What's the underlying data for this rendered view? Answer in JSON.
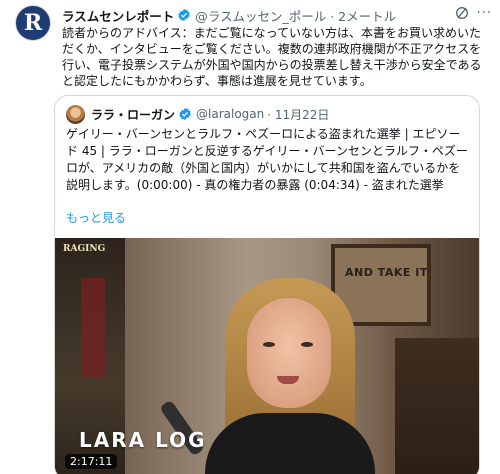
{
  "tweet": {
    "avatar_letter": "R",
    "author_name": "ラスムセンレポート",
    "handle_time": "@ラスムッセン_ポール · 2メートル",
    "more_label": "···",
    "text": "読者からのアドバイス：まだご覧になっていない方は、本書をお買い求めいただくか、インタビューをご覧ください。複数の連邦政府機関が不正アクセスを行い、電子投票システムが外国や国内からの投票差し替え干渉から安全であると認定したにもかかわらず、事態は進展を見せています。"
  },
  "quote": {
    "author_name": "ララ・ローガン",
    "handle": "@laralogan",
    "date": "· 11月22日",
    "text": "ゲイリー・バーンセンとラルフ・ペズーロによる盗まれた選挙 | エピソード 45 | ララ・ローガンと反逆するゲイリー・バーンセンとラルフ・ペズーロが、アメリカの敵（外国と国内）がいかにして共和国を盗んでいるかを説明します。(0:00:00) - 真の権力者の暴露 (0:04:34) - 盗まれた選挙",
    "show_more": "もっと見る",
    "video": {
      "logo": "RAGING",
      "frame_text": "AND TAKE IT",
      "lower_third": "LARA LOG",
      "duration": "2:17:11"
    }
  },
  "colors": {
    "link": "#1d9bf0",
    "verified": "#1d9bf0",
    "secondary_text": "#536471",
    "border": "#cfd9de"
  }
}
